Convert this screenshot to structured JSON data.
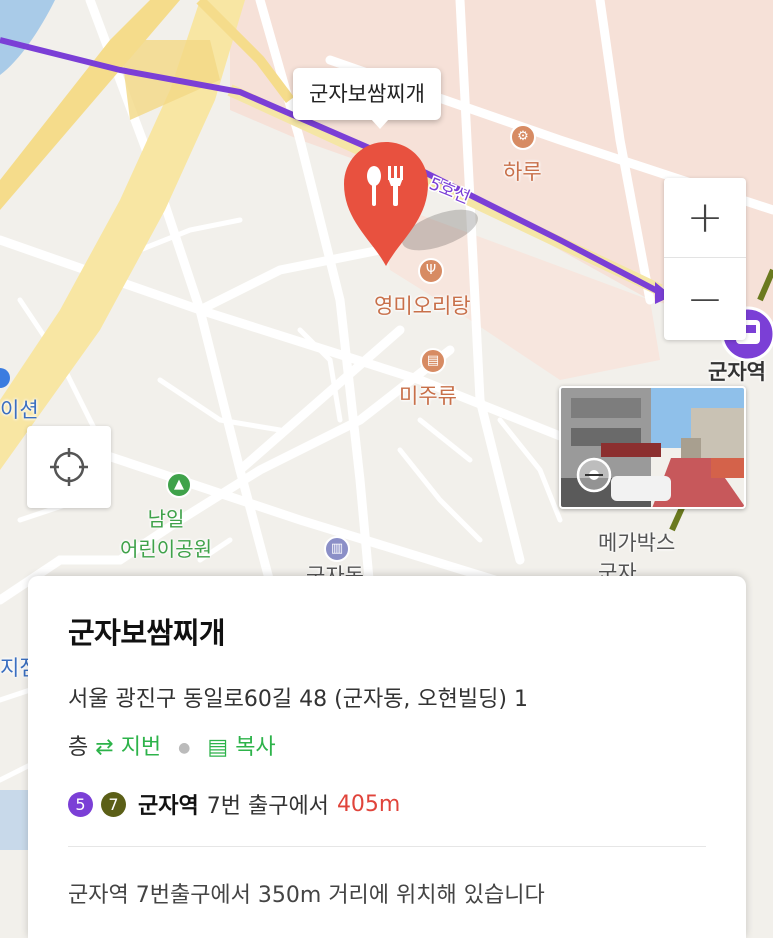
{
  "map": {
    "subway_line_label": "5호선",
    "pois": [
      {
        "name": "하루",
        "icon": "restaurant-icon"
      },
      {
        "name": "영미오리탕",
        "icon": "restaurant-icon"
      },
      {
        "name": "미주류",
        "icon": "bar-icon"
      },
      {
        "name": "남일\n어린이공원",
        "icon": "park-icon"
      },
      {
        "name": "메가박스\n군자",
        "icon": "cinema-icon"
      },
      {
        "name": "군자역",
        "icon": "subway-station-icon"
      },
      {
        "name": "이션",
        "icon": "partial-label"
      },
      {
        "name": "지점",
        "icon": "partial-label"
      },
      {
        "name": "군자동",
        "icon": "partial-label"
      }
    ],
    "selected_place_bubble": "군자보쌈찌개",
    "colors": {
      "subway_line_5": "#7b3fd6",
      "pin": "#e8513f",
      "road_major": "#f7e39a",
      "block": "#f4ddd3"
    }
  },
  "controls": {
    "zoom_in": "+",
    "zoom_out": "−"
  },
  "card": {
    "title": "군자보쌈찌개",
    "address": "서울 광진구 동일로60길 48 (군자동, 오현빌딩) 1층",
    "address_line1": "서울 광진구 동일로60길 48 (군자동, 오현빌딩) 1",
    "address_line2": "층",
    "action_jibun": "지번",
    "action_copy": "복사",
    "subway_lines": [
      {
        "number": "5",
        "color": "#7b3fd6"
      },
      {
        "number": "7",
        "color": "#5b5f17"
      }
    ],
    "station": "군자역",
    "exit_text": "7번 출구에서",
    "distance": "405m",
    "description": "군자역 7번출구에서 350m 거리에 위치해 있습니다"
  }
}
